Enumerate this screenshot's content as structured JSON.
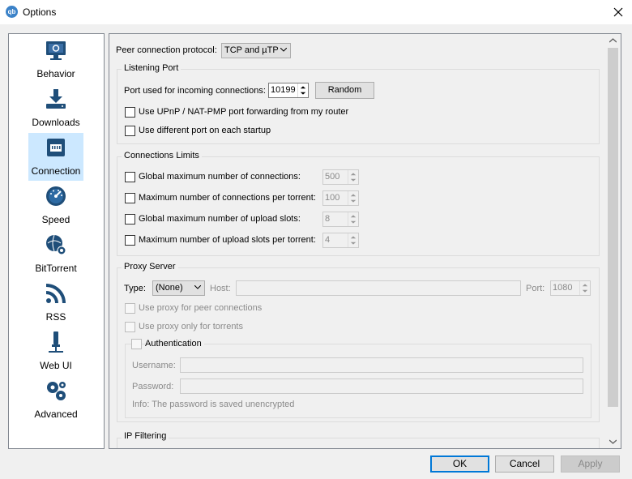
{
  "window": {
    "title": "Options",
    "icon_text": "qb"
  },
  "sidebar": {
    "items": [
      {
        "label": "Behavior",
        "icon": "monitor-icon",
        "active": false
      },
      {
        "label": "Downloads",
        "icon": "download-icon",
        "active": false
      },
      {
        "label": "Connection",
        "icon": "network-icon",
        "active": true
      },
      {
        "label": "Speed",
        "icon": "speedometer-icon",
        "active": false
      },
      {
        "label": "BitTorrent",
        "icon": "globe-gear-icon",
        "active": false
      },
      {
        "label": "RSS",
        "icon": "rss-icon",
        "active": false
      },
      {
        "label": "Web UI",
        "icon": "plug-icon",
        "active": false
      },
      {
        "label": "Advanced",
        "icon": "gears-icon",
        "active": false
      }
    ]
  },
  "connection": {
    "protocol_label": "Peer connection protocol:",
    "protocol_value": "TCP and µTP",
    "listening_port": {
      "title": "Listening Port",
      "port_label": "Port used for incoming connections:",
      "port_value": "10199",
      "random_button": "Random",
      "upnp_label": "Use UPnP / NAT-PMP port forwarding from my router",
      "random_port_label": "Use different port on each startup"
    },
    "limits": {
      "title": "Connections Limits",
      "rows": [
        {
          "label": "Global maximum number of connections:",
          "value": "500"
        },
        {
          "label": "Maximum number of connections per torrent:",
          "value": "100"
        },
        {
          "label": "Global maximum number of upload slots:",
          "value": "8"
        },
        {
          "label": "Maximum number of upload slots per torrent:",
          "value": "4"
        }
      ]
    },
    "proxy": {
      "title": "Proxy Server",
      "type_label": "Type:",
      "type_value": "(None)",
      "host_label": "Host:",
      "port_label": "Port:",
      "port_value": "1080",
      "peer_label": "Use proxy for peer connections",
      "torrents_label": "Use proxy only for torrents",
      "auth_title": "Authentication",
      "username_label": "Username:",
      "password_label": "Password:",
      "info": "Info: The password is saved unencrypted"
    },
    "ip_filtering": {
      "title": "IP Filtering"
    }
  },
  "buttons": {
    "ok": "OK",
    "cancel": "Cancel",
    "apply": "Apply"
  },
  "colors": {
    "accent": "#0078d7",
    "selection": "#cce8ff"
  }
}
